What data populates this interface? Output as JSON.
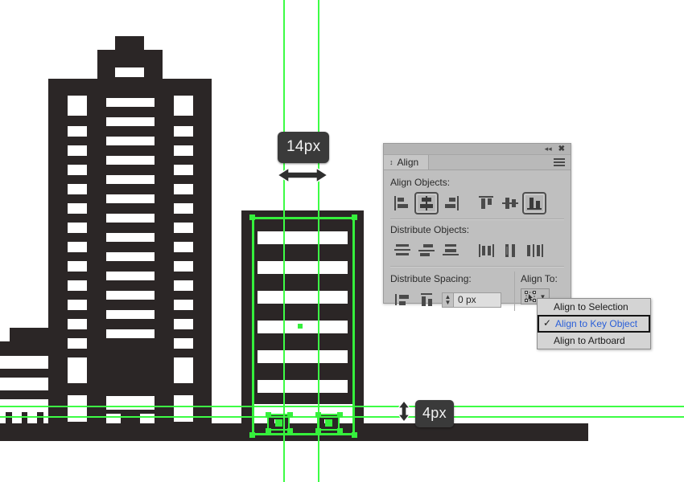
{
  "app": {
    "type": "vector-illustration-editor",
    "canvas_background": "#ffffff",
    "artwork_color": "#2b2626",
    "guide_color": "#3dfd45"
  },
  "measurements": [
    {
      "name": "horizontal-gap",
      "value": "14px",
      "direction": "horizontal"
    },
    {
      "name": "vertical-gap",
      "value": "4px",
      "direction": "vertical"
    }
  ],
  "panel": {
    "title": "Align",
    "header": {
      "collapse_icon": "double-left-chevron",
      "close_icon": "close-x",
      "menu_icon": "hamburger-menu"
    },
    "sections": {
      "align_objects": {
        "label": "Align Objects:",
        "buttons": [
          {
            "name": "horizontal-align-left",
            "selected": false
          },
          {
            "name": "horizontal-align-center",
            "selected": true
          },
          {
            "name": "horizontal-align-right",
            "selected": false
          },
          {
            "name": "vertical-align-top",
            "selected": false
          },
          {
            "name": "vertical-align-center",
            "selected": false
          },
          {
            "name": "vertical-align-bottom",
            "selected": true
          }
        ]
      },
      "distribute_objects": {
        "label": "Distribute Objects:",
        "buttons": [
          {
            "name": "vertical-distribute-top",
            "selected": false
          },
          {
            "name": "vertical-distribute-center",
            "selected": false
          },
          {
            "name": "vertical-distribute-bottom",
            "selected": false
          },
          {
            "name": "horizontal-distribute-left",
            "selected": false
          },
          {
            "name": "horizontal-distribute-center",
            "selected": false
          },
          {
            "name": "horizontal-distribute-right",
            "selected": false
          }
        ]
      },
      "distribute_spacing": {
        "label": "Distribute Spacing:",
        "buttons": [
          {
            "name": "vertical-distribute-space",
            "selected": false
          },
          {
            "name": "horizontal-distribute-space",
            "selected": false
          }
        ],
        "value": "0 px",
        "placeholder": "0 px"
      },
      "align_to": {
        "label": "Align To:",
        "button_icon": "align-to-key-object-icon",
        "chevron": "chevron-down-icon"
      }
    }
  },
  "dropdown": {
    "items": [
      {
        "label": "Align to Selection",
        "checked": false
      },
      {
        "label": "Align to Key Object",
        "checked": true
      },
      {
        "label": "Align to Artboard",
        "checked": false
      }
    ],
    "highlight_color": "#2a5fd8"
  }
}
